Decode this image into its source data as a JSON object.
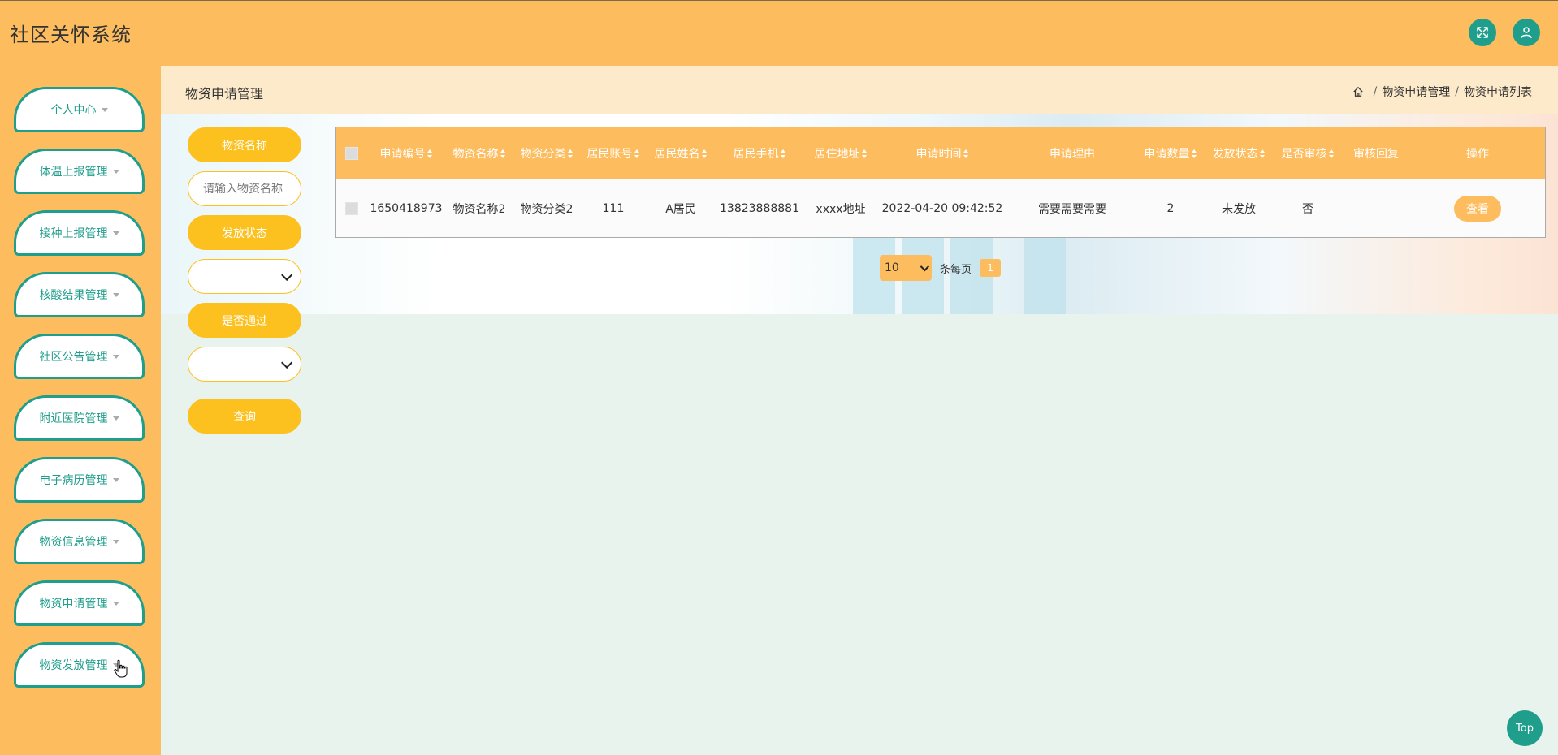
{
  "app": {
    "title": "社区关怀系统"
  },
  "header": {
    "fullscreen_icon": "expand-arrows-icon",
    "user_icon": "user-icon"
  },
  "sidebar": {
    "items": [
      {
        "label": "个人中心"
      },
      {
        "label": "体温上报管理"
      },
      {
        "label": "接种上报管理"
      },
      {
        "label": "核酸结果管理"
      },
      {
        "label": "社区公告管理"
      },
      {
        "label": "附近医院管理"
      },
      {
        "label": "电子病历管理"
      },
      {
        "label": "物资信息管理"
      },
      {
        "label": "物资申请管理"
      },
      {
        "label": "物资发放管理"
      }
    ]
  },
  "page": {
    "title": "物资申请管理",
    "breadcrumb": [
      "物资申请管理",
      "物资申请列表"
    ]
  },
  "search": {
    "name_label": "物资名称",
    "name_placeholder": "请输入物资名称",
    "status_label": "发放状态",
    "status_value": "",
    "pass_label": "是否通过",
    "pass_value": "",
    "query_label": "查询"
  },
  "table": {
    "headers": [
      "申请编号",
      "物资名称",
      "物资分类",
      "居民账号",
      "居民姓名",
      "居民手机",
      "居住地址",
      "申请时间",
      "申请理由",
      "申请数量",
      "发放状态",
      "是否审核",
      "审核回复",
      "操作"
    ],
    "rows": [
      {
        "cells": [
          "1650418973",
          "物资名称2",
          "物资分类2",
          "111",
          "A居民",
          "13823888881",
          "xxxx地址",
          "2022-04-20 09:42:52",
          "需要需要需要",
          "2",
          "未发放",
          "否",
          ""
        ],
        "action": "查看"
      }
    ]
  },
  "pagination": {
    "page_size": "10",
    "per_page_label": "条每页",
    "current_page": "1"
  },
  "top_button": {
    "label": "Top"
  },
  "colors": {
    "header_bg": "#fdbd5e",
    "accent_teal": "#1f9e8c",
    "button_yellow": "#fcc01f"
  }
}
